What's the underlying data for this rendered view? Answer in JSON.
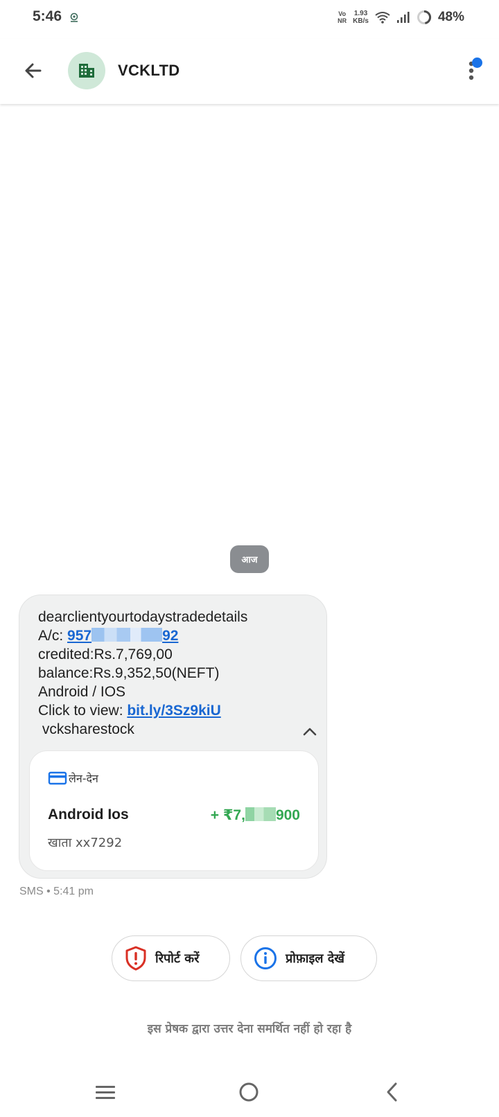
{
  "status_bar": {
    "time": "5:46",
    "network_top": "Vo",
    "network_bottom": "NR",
    "speed_value": "1.93",
    "speed_unit": "KB/s",
    "battery": "48%"
  },
  "header": {
    "contact_name": "VCKLTD",
    "avatar_icon": "business-building-icon",
    "avatar_bg": "#cfe8d8",
    "avatar_fg": "#1e6b3a"
  },
  "conversation": {
    "date_chip": "आज",
    "message": {
      "line1": "dearclientyourtodaystradedetails",
      "account_prefix": "A/c: ",
      "account_start": "957",
      "account_end": "92",
      "line3": "credited:Rs.7,769,00",
      "line4": "balance:Rs.9,352,50(NEFT)",
      "line5": "Android / IOS",
      "link_prefix": "Click to view: ",
      "link_text": "bit.ly/3Sz9kiU",
      "line7": " vcksharestock"
    },
    "transaction_card": {
      "label": "लेन-देन",
      "payee": "Android Ios",
      "amount_prefix": "+ ₹7,",
      "amount_suffix": "900",
      "account": "खाता xx7292"
    },
    "meta": "SMS • 5:41 pm"
  },
  "actions": {
    "report_label": "रिपोर्ट करें",
    "profile_label": "प्रोफ़ाइल देखें"
  },
  "footer_note": "इस प्रेषक द्वारा उत्तर देना समर्थित नहीं हो रहा है",
  "colors": {
    "link": "#1967d2",
    "amount_green": "#34a853",
    "report_red": "#d93025",
    "info_blue": "#1a73e8"
  }
}
